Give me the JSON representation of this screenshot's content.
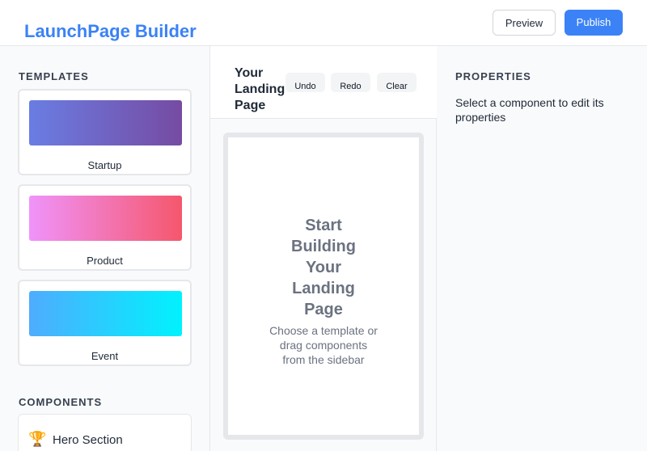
{
  "header": {
    "brand": "LaunchPage Builder",
    "preview_label": "Preview",
    "publish_label": "Publish"
  },
  "sidebar": {
    "templates_title": "TEMPLATES",
    "templates": [
      {
        "name": "Startup"
      },
      {
        "name": "Product"
      },
      {
        "name": "Event"
      }
    ],
    "components_title": "COMPONENTS",
    "components": [
      {
        "label": "Hero Section",
        "icon": "trophy-icon",
        "glyph": "🏆"
      }
    ]
  },
  "canvas": {
    "title": "Your Landing Page",
    "undo_label": "Undo",
    "redo_label": "Redo",
    "clear_label": "Clear",
    "empty_title": "Start Building Your Landing Page",
    "empty_subtitle": "Choose a template or drag components from the sidebar"
  },
  "properties": {
    "title": "PROPERTIES",
    "hint": "Select a component to edit its properties"
  },
  "colors": {
    "accent": "#3b82f6"
  }
}
